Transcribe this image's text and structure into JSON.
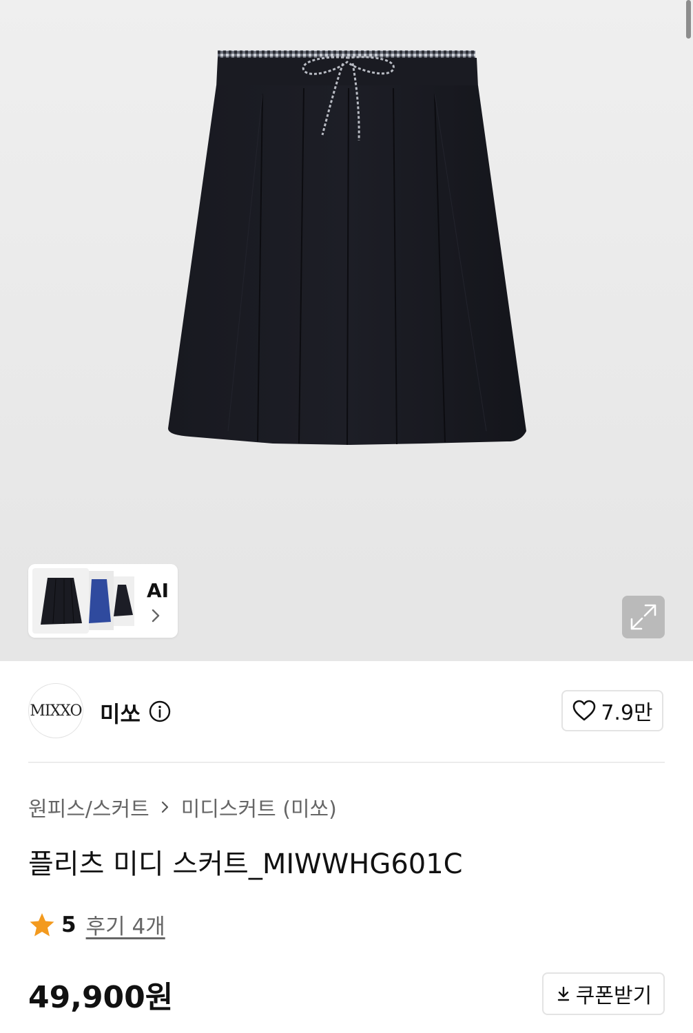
{
  "ai_gallery": {
    "label": "AI"
  },
  "brand": {
    "logo_text": "MIXXO",
    "name": "미쏘"
  },
  "likes": {
    "count": "7.9만"
  },
  "breadcrumb": {
    "category": "원피스/스커트",
    "subcategory": "미디스커트 (미쏘)"
  },
  "product": {
    "title": "플리츠 미디 스커트_MIWWHG601C",
    "rating": "5",
    "reviews": "후기 4개",
    "price": "49,900원"
  },
  "coupon": {
    "label": "쿠폰받기"
  },
  "colors": {
    "skirt": "#15161c",
    "star": "#f39a1e",
    "thumb_blue": "#2f4a9e"
  },
  "icons": [
    "chevron-right-icon",
    "expand-icon",
    "info-icon",
    "heart-icon",
    "download-icon",
    "star-icon"
  ]
}
